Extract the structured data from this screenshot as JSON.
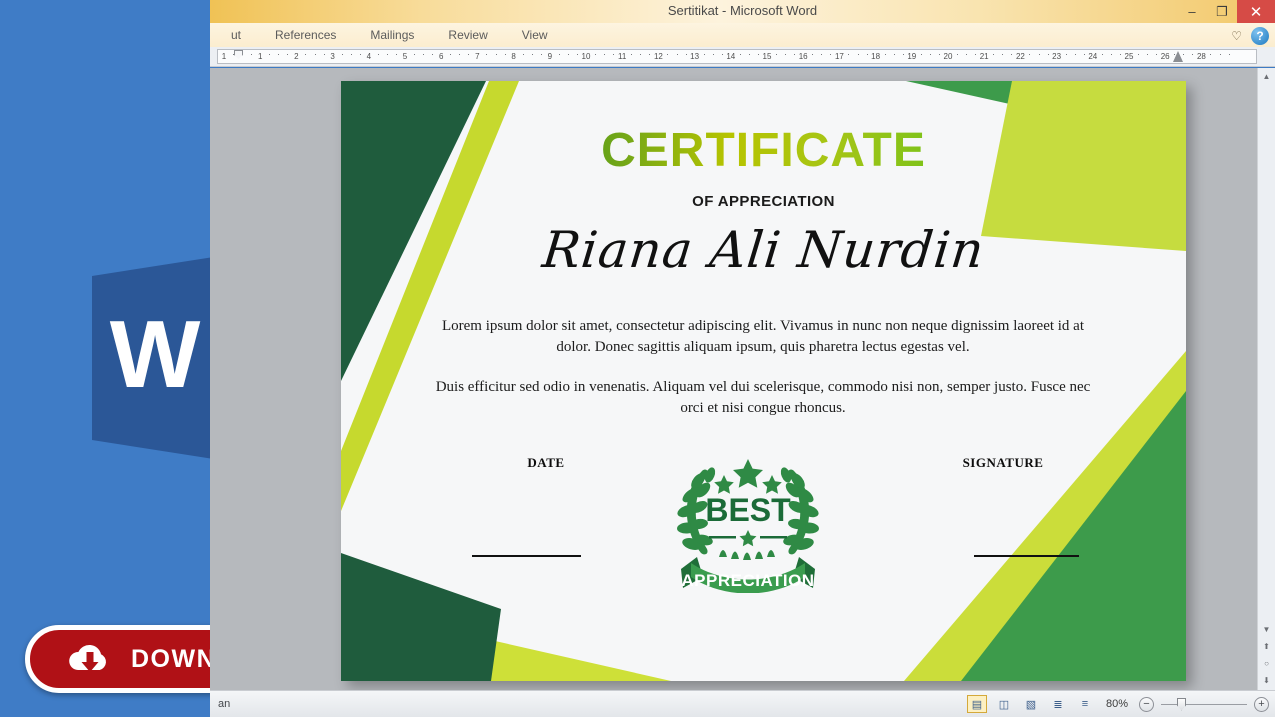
{
  "window": {
    "title": "Sertitikat  -  Microsoft Word",
    "controls": {
      "minimize": "–",
      "restore": "❐",
      "close": "✕"
    }
  },
  "ribbon": {
    "tabs": [
      {
        "label": "ut"
      },
      {
        "label": "References"
      },
      {
        "label": "Mailings"
      },
      {
        "label": "Review"
      },
      {
        "label": "View"
      }
    ],
    "heart_icon": "♡",
    "help_icon": "?"
  },
  "ruler": {
    "ticks": [
      "1",
      "1",
      "2",
      "3",
      "4",
      "5",
      "6",
      "7",
      "8",
      "9",
      "10",
      "11",
      "12",
      "13",
      "14",
      "15",
      "16",
      "17",
      "18",
      "19",
      "20",
      "21",
      "22",
      "23",
      "24",
      "25",
      "26",
      "28"
    ]
  },
  "promo": {
    "download_label": "DOWNLOAD",
    "download_bg": "#b01116",
    "panel_bg": "#3f7cc6",
    "word_logo_name": "microsoft-word-logo",
    "cloud_icon": "cloud-download-icon"
  },
  "status_bar": {
    "language": "an",
    "zoom_level": "80%",
    "zoom_out": "−",
    "zoom_in": "+",
    "view_buttons": [
      {
        "name": "print-layout-view",
        "glyph": "▤",
        "active": true
      },
      {
        "name": "read-mode-view",
        "glyph": "◫",
        "active": false
      },
      {
        "name": "web-layout-view",
        "glyph": "▧",
        "active": false
      },
      {
        "name": "outline-view",
        "glyph": "≣",
        "active": false
      },
      {
        "name": "draft-view",
        "glyph": "≡",
        "active": false
      }
    ]
  },
  "scrollbar": {
    "up": "▲",
    "down": "▼",
    "previous_page": "⬆",
    "browse_object": "○",
    "next_page": "⬇"
  },
  "certificate": {
    "title": "CERTIFICATE",
    "subtitle": "OF APPRECIATION",
    "recipient_name": "Riana Ali Nurdin",
    "paragraphs": [
      "Lorem ipsum dolor sit amet, consectetur adipiscing elit. Vivamus in nunc non neque dignissim laoreet id at dolor. Donec sagittis aliquam ipsum, quis pharetra lectus egestas vel.",
      "Duis efficitur sed odio in venenatis. Aliquam vel dui scelerisque, commodo nisi non, semper justo. Fusce nec orci et nisi congue rhoncus."
    ],
    "date_label": "DATE",
    "signature_label": "SIGNATURE",
    "seal": {
      "top_text": "BEST",
      "ribbon_text": "APPRECIATION",
      "icon_name": "laurel-wreath-badge"
    },
    "colors": {
      "dark_green": "#1f5c3d",
      "medium_green": "#3d9b4b",
      "lime_green": "#c6d92e",
      "page_bg": "#f6f7f8"
    }
  }
}
